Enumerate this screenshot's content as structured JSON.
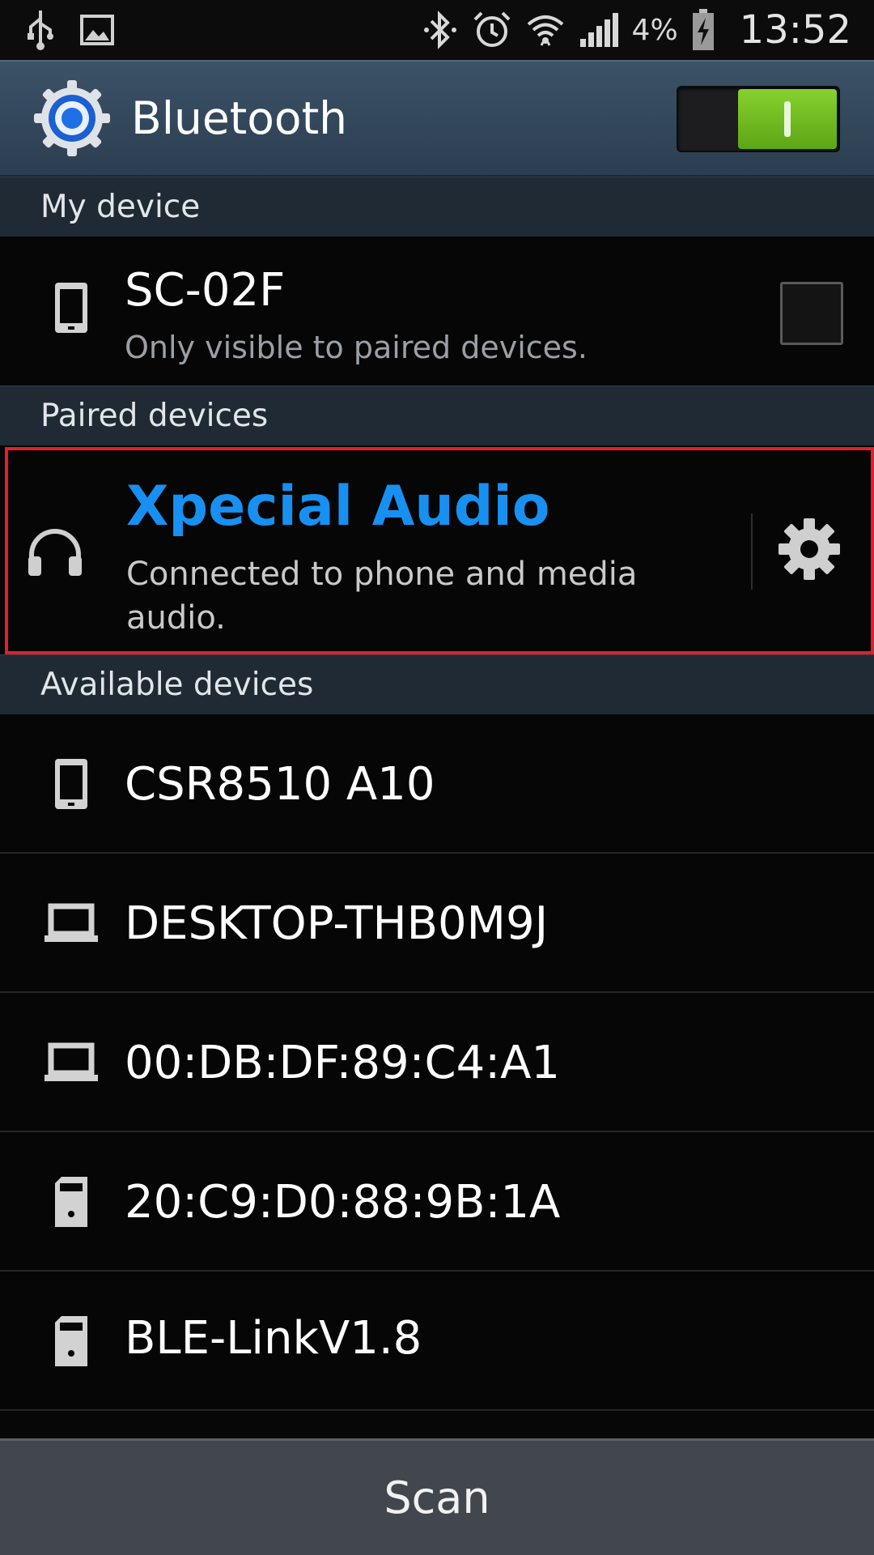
{
  "status_bar": {
    "left_icons": [
      "usb-icon",
      "image-icon"
    ],
    "right_icons": [
      "bluetooth-icon",
      "alarm-icon",
      "wifi-icon",
      "signal-icon",
      "battery-icon"
    ],
    "battery_percent": "4%",
    "time": "13:52"
  },
  "action_bar": {
    "title": "Bluetooth",
    "icon": "bluetooth-settings-gear-icon",
    "toggle_state": "on",
    "toggle_color": "#6fbf1f"
  },
  "sections": {
    "my_device": "My device",
    "paired": "Paired devices",
    "available": "Available devices"
  },
  "my_device": {
    "name": "SC-02F",
    "visibility": "Only visible to paired devices.",
    "icon": "phone-icon",
    "visible_checked": false
  },
  "paired_devices": [
    {
      "name": "Xpecial Audio",
      "status": "Connected to phone and media audio.",
      "icon": "headphones-icon",
      "accent_color": "#1790f1"
    }
  ],
  "available_devices": [
    {
      "name": "CSR8510 A10",
      "icon": "phone-icon"
    },
    {
      "name": "DESKTOP-THB0M9J",
      "icon": "laptop-icon"
    },
    {
      "name": "00:DB:DF:89:C4:A1",
      "icon": "laptop-icon"
    },
    {
      "name": "20:C9:D0:88:9B:1A",
      "icon": "generic-device-icon"
    },
    {
      "name": "BLE-LinkV1.8",
      "icon": "generic-device-icon"
    }
  ],
  "scan_button": "Scan"
}
